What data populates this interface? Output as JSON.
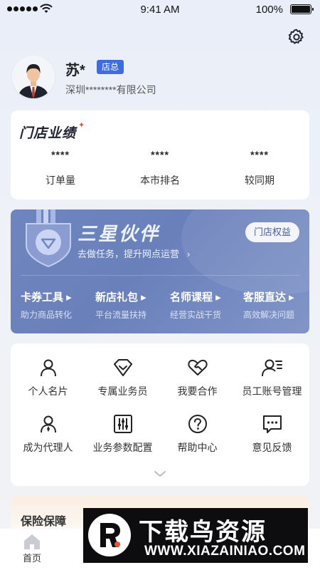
{
  "status_bar": {
    "time": "9:41 AM",
    "battery": "100%"
  },
  "profile": {
    "name": "苏*",
    "role_badge": "店总",
    "company": "深圳********有限公司"
  },
  "performance": {
    "title": "门店业绩",
    "stats": [
      {
        "value": "****",
        "label": "订单量"
      },
      {
        "value": "****",
        "label": "本市排名"
      },
      {
        "value": "****",
        "label": "较同期"
      }
    ]
  },
  "partner": {
    "title": "三星伙伴",
    "subtitle": "去做任务，提升网点运营",
    "rights_button": "门店权益",
    "items": [
      {
        "title": "卡券工具",
        "subtitle": "助力商品转化"
      },
      {
        "title": "新店礼包",
        "subtitle": "平台流量扶持"
      },
      {
        "title": "名师课程",
        "subtitle": "经营实战干货"
      },
      {
        "title": "客服直达",
        "subtitle": "高效解决问题"
      }
    ]
  },
  "tools": [
    {
      "label": "个人名片",
      "icon": "person-icon"
    },
    {
      "label": "专属业务员",
      "icon": "diamond-icon"
    },
    {
      "label": "我要合作",
      "icon": "handshake-heart-icon"
    },
    {
      "label": "员工账号管理",
      "icon": "staff-list-icon"
    },
    {
      "label": "成为代理人",
      "icon": "agent-icon"
    },
    {
      "label": "业务参数配置",
      "icon": "sliders-icon"
    },
    {
      "label": "帮助中心",
      "icon": "question-icon"
    },
    {
      "label": "意见反馈",
      "icon": "chat-dots-icon"
    }
  ],
  "insurance": {
    "title": "保险保障"
  },
  "tab_bar": {
    "home": "首页"
  },
  "watermark": {
    "title": "下载鸟资源",
    "url": "WWW.XIAZAINIAO.COM"
  },
  "colors": {
    "accent": "#3f6de0",
    "banner": "#6f85be"
  }
}
